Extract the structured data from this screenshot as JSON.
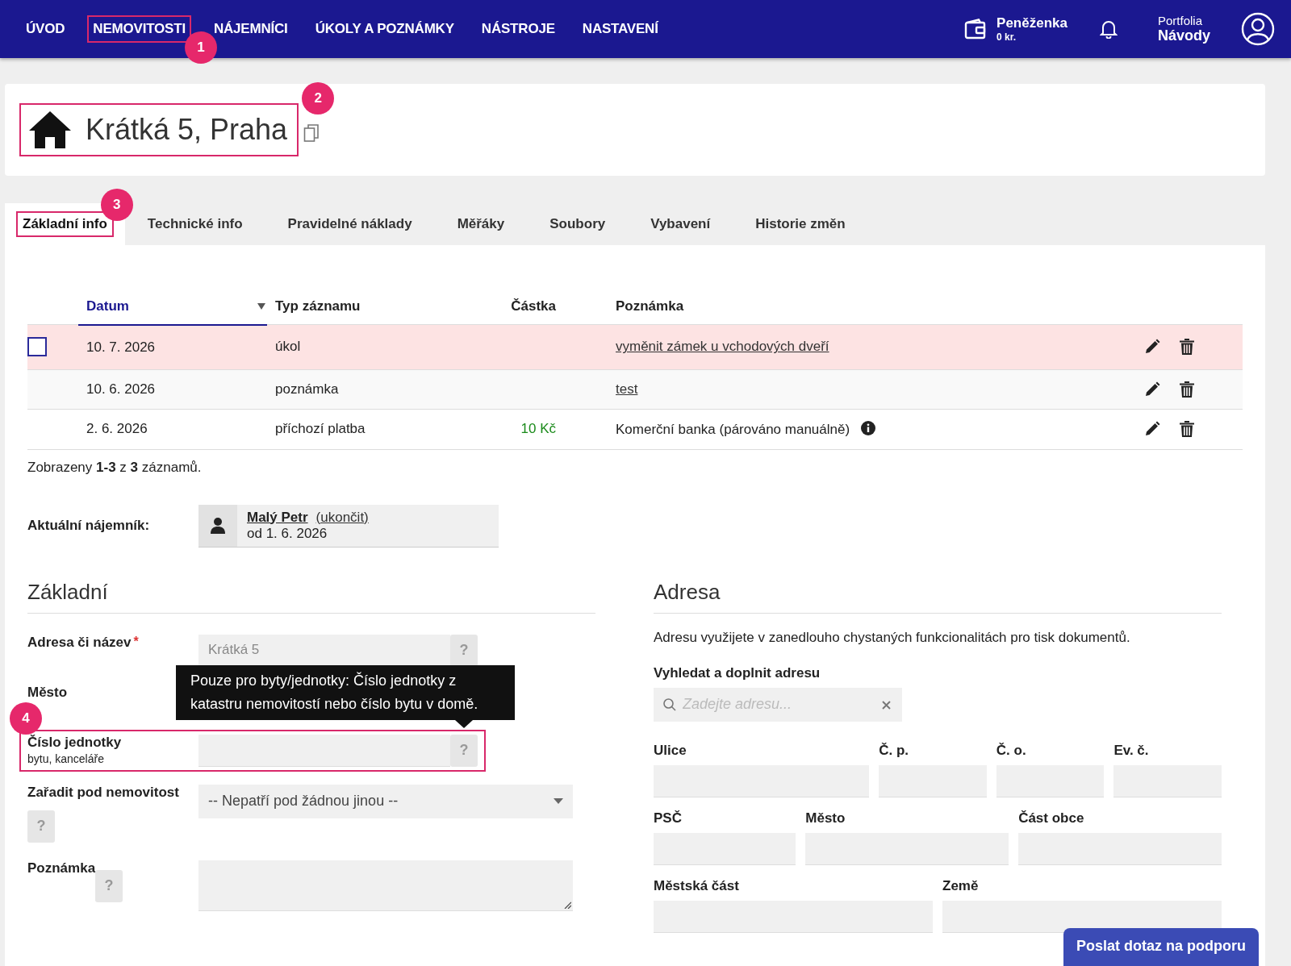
{
  "nav": {
    "items": [
      {
        "label": "ÚVOD"
      },
      {
        "label": "NEMOVITOSTI",
        "callout": "1"
      },
      {
        "label": "NÁJEMNÍCI"
      },
      {
        "label": "ÚKOLY A POZNÁMKY"
      },
      {
        "label": "NÁSTROJE"
      },
      {
        "label": "NASTAVENÍ"
      }
    ],
    "wallet": {
      "label": "Peněženka",
      "amount": "0 kr."
    },
    "portfolio": {
      "caption": "Portfolia",
      "name": "Návody"
    }
  },
  "property": {
    "title": "Krátká 5, Praha",
    "callout": "2"
  },
  "tabs": [
    {
      "label": "Základní info",
      "selected": true,
      "callout": "3"
    },
    {
      "label": "Technické info",
      "selected": false
    },
    {
      "label": "Pravidelné náklady",
      "selected": false
    },
    {
      "label": "Měřáky",
      "selected": false
    },
    {
      "label": "Soubory",
      "selected": false
    },
    {
      "label": "Vybavení",
      "selected": false
    },
    {
      "label": "Historie změn",
      "selected": false
    }
  ],
  "table": {
    "columns": [
      {
        "label": "Datum",
        "sorted": true
      },
      {
        "label": "Typ záznamu",
        "sorted": false
      },
      {
        "label": "Částka",
        "sorted": false
      },
      {
        "label": "Poznámka",
        "sorted": false
      }
    ],
    "rows": [
      {
        "kind": "task",
        "checked": false,
        "highlighted": true,
        "date": "10. 7. 2026",
        "type": "úkol",
        "amount": "",
        "note": "vyměnit zámek u vchodových dveří",
        "note_link": true,
        "info": false
      },
      {
        "kind": "note",
        "highlighted": false,
        "date": "10. 6. 2026",
        "type": "poznámka",
        "amount": "",
        "note": "test",
        "note_link": true,
        "info": false
      },
      {
        "kind": "payment",
        "highlighted": false,
        "date": "2. 6. 2026",
        "type": "příchozí platba",
        "amount": "10 Kč",
        "note": "Komerční banka (párováno manuálně)",
        "note_link": false,
        "info": true
      }
    ],
    "summary": "Zobrazeny **1-3** z **3** záznamů."
  },
  "tenant": {
    "label": "Aktuální nájemník:",
    "name": "Malý Petr",
    "end_link": "(ukončit)",
    "since": "od 1. 6. 2026"
  },
  "basic": {
    "title": "Základní",
    "fields": [
      {
        "kind": "text",
        "label": "Adresa či název",
        "required_mark": "*",
        "value": "Krátká 5",
        "help": "?"
      },
      {
        "kind": "text",
        "label": "Město"
      },
      {
        "kind": "text",
        "label": "Číslo jednotky",
        "sublabel": "bytu, kanceláře",
        "help": "?",
        "callout": "4"
      },
      {
        "kind": "select",
        "label": "Zařadit pod nemovitost",
        "value": "-- Nepatří pod žádnou jinou --",
        "help_below": "?"
      },
      {
        "kind": "textarea",
        "label": "Poznámka",
        "help_below": "?"
      }
    ],
    "tooltip": "Pouze pro byty/jednotky: Číslo jednotky z katastru nemovitostí nebo číslo bytu v domě."
  },
  "address": {
    "title": "Adresa",
    "description": "Adresu využijete v zanedlouho chystaných funkcionalitách pro tisk dokumentů.",
    "search": {
      "label": "Vyhledat a doplnit adresu",
      "placeholder": "Zadejte adresu..."
    },
    "rows": [
      [
        {
          "label": "Ulice"
        },
        {
          "label": "Č. p."
        },
        {
          "label": "Č. o."
        },
        {
          "label": "Ev. č."
        }
      ],
      [
        {
          "label": "PSČ"
        },
        {
          "label": "Město"
        },
        {
          "label": "Část obce"
        }
      ],
      [
        {
          "label": "Městská část"
        },
        {
          "label": "Země"
        }
      ]
    ]
  },
  "support_button": "Poslat dotaz na podporu"
}
